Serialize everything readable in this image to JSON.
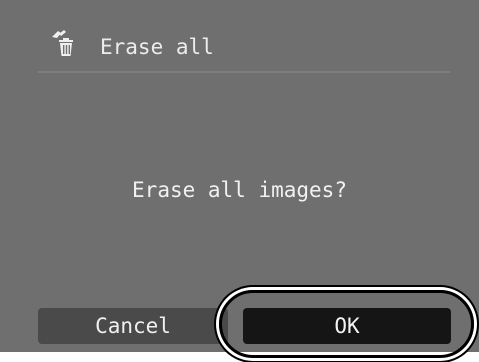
{
  "header": {
    "title": "Erase all",
    "icon": "erase-trash-icon"
  },
  "dialog": {
    "message": "Erase all images?"
  },
  "buttons": {
    "cancel_label": "Cancel",
    "ok_label": "OK"
  },
  "colors": {
    "screen_background": "#6f6f6f",
    "selected_button": "#151515",
    "unselected_button": "#4a4a4a",
    "text": "#ececec"
  }
}
